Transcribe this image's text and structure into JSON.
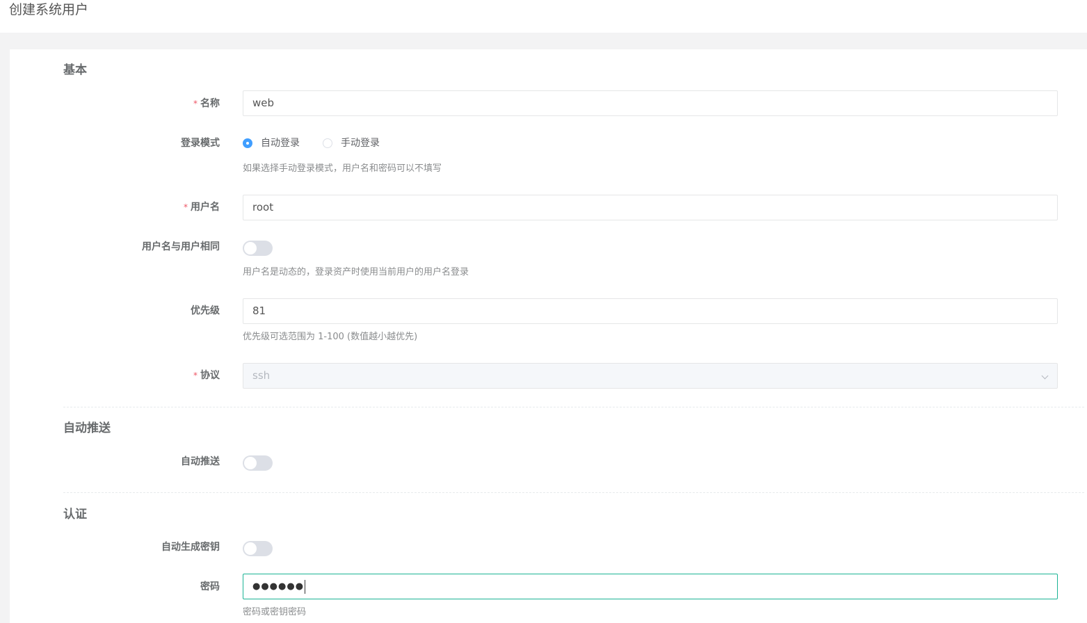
{
  "page": {
    "title": "创建系统用户"
  },
  "sections": {
    "basic": "基本",
    "auto_push": "自动推送",
    "auth": "认证"
  },
  "fields": {
    "name": {
      "label": "名称",
      "value": "web"
    },
    "login_mode": {
      "label": "登录模式",
      "options": [
        "自动登录",
        "手动登录"
      ],
      "selected": "自动登录",
      "help": "如果选择手动登录模式，用户名和密码可以不填写"
    },
    "username": {
      "label": "用户名",
      "value": "root"
    },
    "username_same_as_user": {
      "label": "用户名与用户相同",
      "on": false,
      "help": "用户名是动态的，登录资产时使用当前用户的用户名登录"
    },
    "priority": {
      "label": "优先级",
      "value": "81",
      "help": "优先级可选范围为 1-100 (数值越小越优先)"
    },
    "protocol": {
      "label": "协议",
      "value": "ssh"
    },
    "auto_push": {
      "label": "自动推送",
      "on": false
    },
    "auto_generate_key": {
      "label": "自动生成密钥",
      "on": false
    },
    "password": {
      "label": "密码",
      "value": "●●●●●●",
      "help": "密码或密钥密码"
    }
  },
  "required_mark": "*"
}
